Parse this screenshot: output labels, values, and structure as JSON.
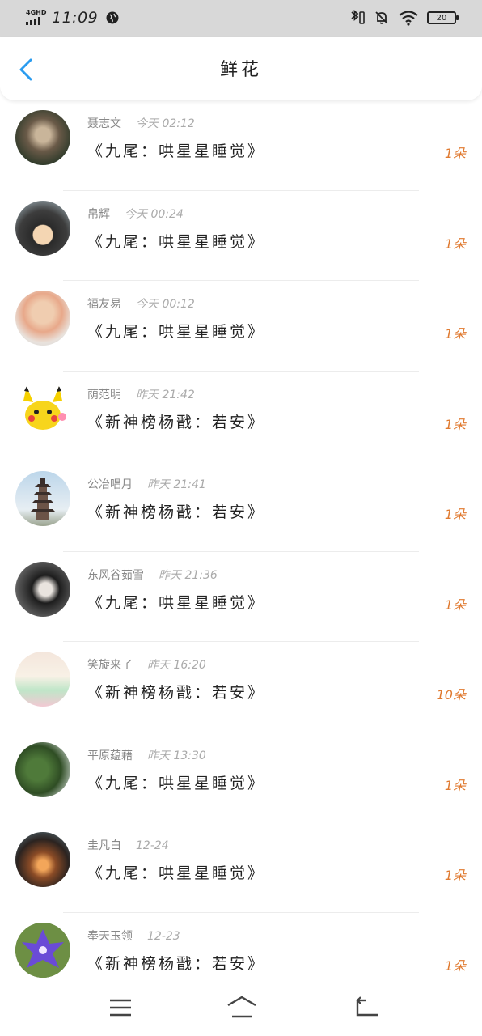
{
  "status_bar": {
    "network": "4GHD",
    "time": "11:09",
    "battery": "20"
  },
  "header": {
    "title": "鲜花"
  },
  "items": [
    {
      "user": "聂志文",
      "when": "今天 02:12",
      "work": "《九尾：哄星星睡觉》",
      "count": "1朵",
      "avatar_desc": "person-photo-dark"
    },
    {
      "user": "帛辉",
      "when": "今天 00:24",
      "work": "《九尾：哄星星睡觉》",
      "count": "1朵",
      "avatar_desc": "girl-mask-photo"
    },
    {
      "user": "福友易",
      "when": "今天 00:12",
      "work": "《九尾：哄星星睡觉》",
      "count": "1朵",
      "avatar_desc": "boy-glasses-photo"
    },
    {
      "user": "荫范明",
      "when": "昨天 21:42",
      "work": "《新神榜杨戬：若安》",
      "count": "1朵",
      "avatar_desc": "pikachu"
    },
    {
      "user": "公冶唱月",
      "when": "昨天 21:41",
      "work": "《新神榜杨戬：若安》",
      "count": "1朵",
      "avatar_desc": "pagoda"
    },
    {
      "user": "东风谷茹雪",
      "when": "昨天 21:36",
      "work": "《九尾：哄星星睡觉》",
      "count": "1朵",
      "avatar_desc": "woman-dark-portrait"
    },
    {
      "user": "笑旋来了",
      "when": "昨天 16:20",
      "work": "《新神榜杨戬：若安》",
      "count": "10朵",
      "avatar_desc": "pastel-dress"
    },
    {
      "user": "平原蕴藉",
      "when": "昨天 13:30",
      "work": "《九尾：哄星星睡觉》",
      "count": "1朵",
      "avatar_desc": "green-plant"
    },
    {
      "user": "圭凡白",
      "when": "12-24",
      "work": "《九尾：哄星星睡觉》",
      "count": "1朵",
      "avatar_desc": "lights-jar"
    },
    {
      "user": "奉天玉领",
      "when": "12-23",
      "work": "《新神榜杨戬：若安》",
      "count": "1朵",
      "avatar_desc": "purple-flower"
    }
  ],
  "colors": {
    "accent": "#2a9cf0",
    "count": "#e07a30",
    "statusbar": "#d8d8d8"
  }
}
